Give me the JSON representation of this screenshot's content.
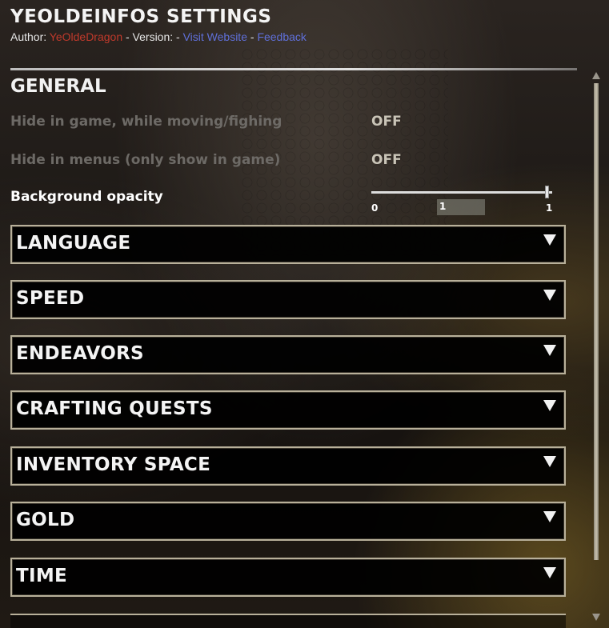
{
  "header": {
    "title": "YEOLDEINFOS SETTINGS",
    "author_label": "Author: ",
    "author": "YeOldeDragon",
    "version_label": " - Version: - ",
    "website_link": "Visit Website",
    "sep": " - ",
    "feedback_link": "Feedback"
  },
  "general": {
    "title": "GENERAL",
    "settings": [
      {
        "label": "Hide in game, while moving/fighing",
        "value": "OFF",
        "enabled": false
      },
      {
        "label": "Hide in menus (only show in game)",
        "value": "OFF",
        "enabled": false
      }
    ],
    "opacity": {
      "label": "Background opacity",
      "min": "0",
      "max": "1",
      "current": "1",
      "fraction": 1.0
    }
  },
  "sections": [
    {
      "label": "LANGUAGE"
    },
    {
      "label": "SPEED"
    },
    {
      "label": "ENDEAVORS"
    },
    {
      "label": "CRAFTING QUESTS"
    },
    {
      "label": "INVENTORY SPACE"
    },
    {
      "label": "GOLD"
    },
    {
      "label": "TIME"
    }
  ],
  "colors": {
    "author": "#c0392b",
    "link": "#5f6fd8",
    "disabled_text": "#6d6a66",
    "border": "#b8b09a"
  },
  "icons": {
    "dropdown": "triangle-down-icon",
    "scroll_up": "arrow-up-icon",
    "scroll_down": "arrow-down-icon"
  }
}
